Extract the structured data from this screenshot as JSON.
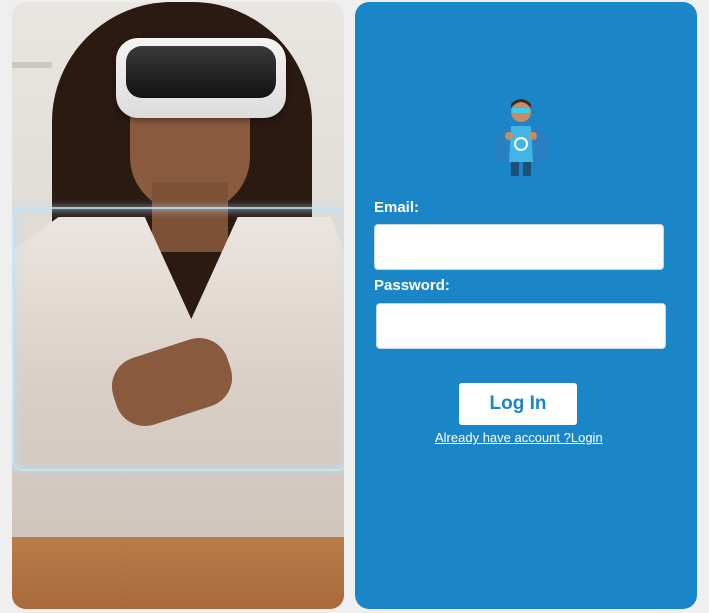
{
  "form": {
    "email_label": "Email:",
    "email_value": "",
    "password_label": "Password:",
    "password_value": "",
    "login_button": "Log In",
    "account_link": "Already have account ?Login"
  },
  "colors": {
    "panel_blue": "#1a85c7",
    "background": "#efefef"
  },
  "icons": {
    "avatar": "superhero-mascot-icon"
  }
}
